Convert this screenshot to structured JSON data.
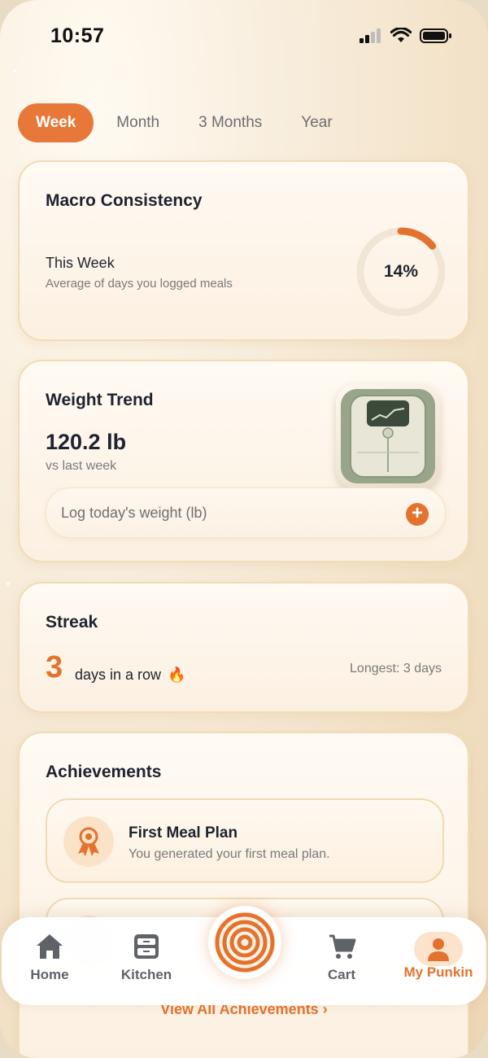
{
  "status_bar": {
    "time": "10:57"
  },
  "tabs": [
    {
      "label": "Week",
      "active": true
    },
    {
      "label": "Month",
      "active": false
    },
    {
      "label": "3 Months",
      "active": false
    },
    {
      "label": "Year",
      "active": false
    }
  ],
  "macro": {
    "title": "Macro Consistency",
    "period": "This Week",
    "description": "Average of days you logged meals",
    "percent_label": "14%",
    "percent_value": 14
  },
  "weight": {
    "title": "Weight Trend",
    "value": "120.2 lb",
    "comparison": "vs last week",
    "input_placeholder": "Log today's weight (lb)"
  },
  "streak": {
    "title": "Streak",
    "count": "3",
    "label": "days in a row",
    "emoji": "🔥",
    "longest": "Longest: 3 days"
  },
  "achievements": {
    "title": "Achievements",
    "items": [
      {
        "title": "First Meal Plan",
        "description": "You generated your first meal plan.",
        "icon": "award-icon"
      }
    ],
    "view_all": "View All Achievements ›"
  },
  "nav": {
    "items": [
      {
        "label": "Home",
        "icon": "home-icon"
      },
      {
        "label": "Kitchen",
        "icon": "kitchen-icon"
      },
      {
        "label": "",
        "icon": "spiral-logo-icon"
      },
      {
        "label": "Cart",
        "icon": "cart-icon"
      },
      {
        "label": "My Punkin",
        "icon": "person-icon",
        "active": true
      }
    ]
  },
  "colors": {
    "accent": "#e4722f",
    "text": "#1f2330",
    "muted": "#7a7a7a"
  }
}
